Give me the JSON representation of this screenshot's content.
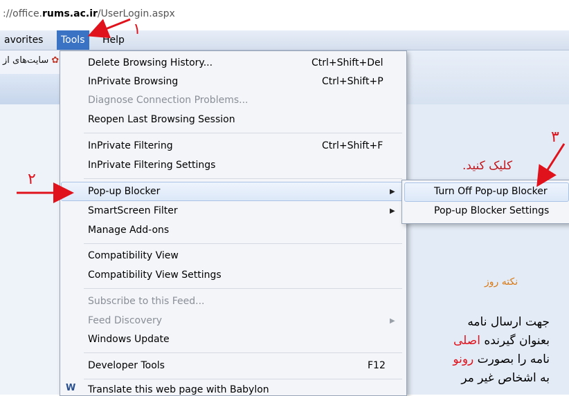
{
  "address": {
    "prefix": "://office.",
    "host": "rums.ac.ir",
    "path": "/UserLogin.aspx"
  },
  "menubar": {
    "favorites": "avorites",
    "tools": "Tools",
    "help": "Help"
  },
  "favorites_bar": {
    "text": "سایت‌ها‌ی از"
  },
  "tools_menu": {
    "items": [
      {
        "label": "Delete Browsing History...",
        "shortcut": "Ctrl+Shift+Del",
        "enabled": true
      },
      {
        "label": "InPrivate Browsing",
        "shortcut": "Ctrl+Shift+P",
        "enabled": true
      },
      {
        "label": "Diagnose Connection Problems...",
        "shortcut": "",
        "enabled": false
      },
      {
        "label": "Reopen Last Browsing Session",
        "shortcut": "",
        "enabled": true
      },
      {
        "label": "InPrivate Filtering",
        "shortcut": "Ctrl+Shift+F",
        "enabled": true
      },
      {
        "label": "InPrivate Filtering Settings",
        "shortcut": "",
        "enabled": true
      },
      {
        "label": "Pop-up Blocker",
        "shortcut": "",
        "enabled": true,
        "submenu": true
      },
      {
        "label": "SmartScreen Filter",
        "shortcut": "",
        "enabled": true,
        "submenu": true
      },
      {
        "label": "Manage Add-ons",
        "shortcut": "",
        "enabled": true
      },
      {
        "label": "Compatibility View",
        "shortcut": "",
        "enabled": true
      },
      {
        "label": "Compatibility View Settings",
        "shortcut": "",
        "enabled": true
      },
      {
        "label": "Subscribe to this Feed...",
        "shortcut": "",
        "enabled": false
      },
      {
        "label": "Feed Discovery",
        "shortcut": "",
        "enabled": false,
        "submenu": true
      },
      {
        "label": "Windows Update",
        "shortcut": "",
        "enabled": true
      },
      {
        "label": "Developer Tools",
        "shortcut": "F12",
        "enabled": true
      },
      {
        "label": "Translate this web page with Babylon",
        "shortcut": "",
        "enabled": true
      }
    ]
  },
  "popup_submenu": {
    "items": [
      {
        "label": "Turn Off Pop-up Blocker"
      },
      {
        "label": "Pop-up Blocker Settings"
      }
    ]
  },
  "page": {
    "click_label": "کلیک کنید.",
    "tip_title": "نکته روز",
    "lines": [
      {
        "text": "جهت ارسال نامه",
        "red": ""
      },
      {
        "text": "بعنوان گیرنده ",
        "red": "اصلی"
      },
      {
        "text": "نامه را بصورت ",
        "red": "رونو"
      },
      {
        "text": "به اشخاص غیر مر",
        "red": ""
      }
    ]
  },
  "annotations": {
    "step1": "١",
    "step2": "٢",
    "step3": "٣",
    "arrow_color": "#e0121b"
  },
  "colors": {
    "menu_highlight": "#3a73c4",
    "menu_bg": "#f3f5f9",
    "accent_red": "#e0121b",
    "tip_orange": "#d97a16"
  }
}
